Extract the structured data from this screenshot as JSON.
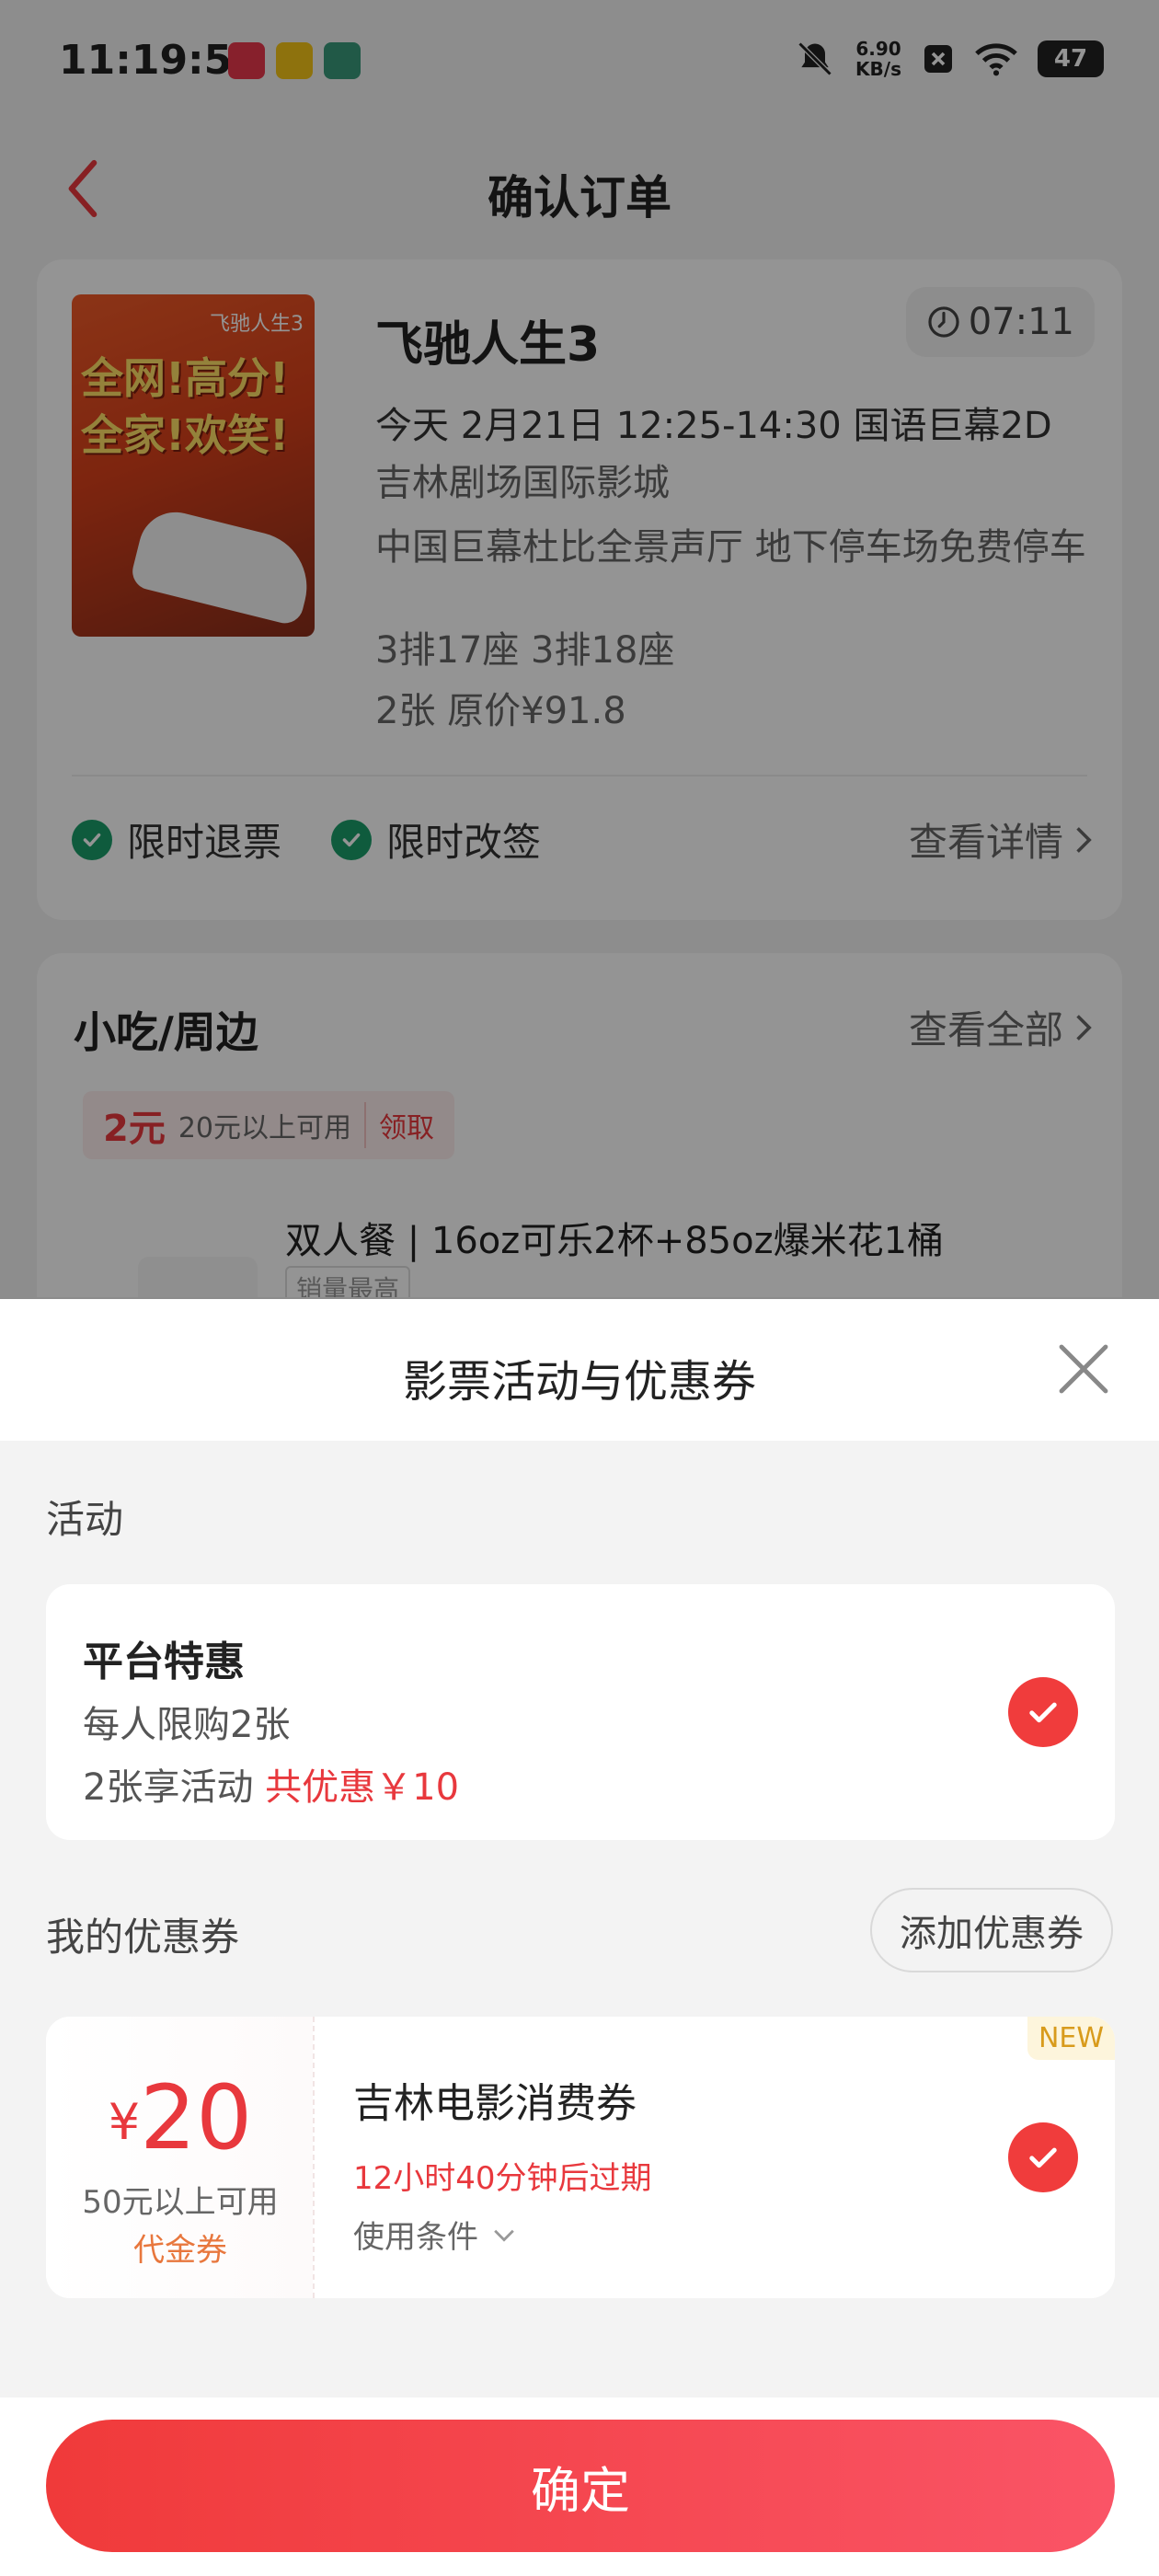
{
  "status_bar": {
    "time": "11:19:55",
    "net_speed_value": "6.90",
    "net_speed_unit": "KB/s",
    "battery": "47"
  },
  "nav": {
    "title": "确认订单"
  },
  "order": {
    "movie_title": "飞驰人生3",
    "countdown": "07:11",
    "showtime": "今天 2月21日 12:25-14:30 国语巨幕2D",
    "cinema": "吉林剧场国际影城",
    "hall": "中国巨幕杜比全景声厅 地下停车场免费停车",
    "seats": "3排17座 3排18座",
    "price_info": "2张 原价¥91.8",
    "badges": [
      "限时退票",
      "限时改签"
    ],
    "detail_link": "查看详情",
    "poster_tag": "飞驰人生3",
    "poster_slogan": "全网!高分!全家!欢笑!"
  },
  "snacks": {
    "title": "小吃/周边",
    "view_all": "查看全部",
    "coupon_amount": "2元",
    "coupon_condition": "20元以上可用",
    "coupon_claim": "领取",
    "item_name": "双人餐 | 16oz可乐2杯+85oz爆米花1桶",
    "item_tag": "销量最高"
  },
  "sheet": {
    "title": "影票活动与优惠券",
    "activity_section": "活动",
    "activity": {
      "title": "平台特惠",
      "limit": "每人限购2张",
      "discount_prefix": "2张享活动",
      "discount_amount": "共优惠￥10",
      "selected": true
    },
    "coupon_section": "我的优惠券",
    "add_coupon_label": "添加优惠券",
    "coupon": {
      "currency": "¥",
      "amount": "20",
      "condition": "50元以上可用",
      "type": "代金券",
      "name": "吉林电影消费券",
      "expire": "12小时40分钟后过期",
      "terms": "使用条件",
      "badge": "NEW",
      "selected": true
    },
    "confirm_label": "确定"
  },
  "colors": {
    "accent_red": "#e8383d",
    "check_red": "#f03c3c",
    "check_green": "#1b9d6a",
    "new_badge": "#d89b1c"
  }
}
